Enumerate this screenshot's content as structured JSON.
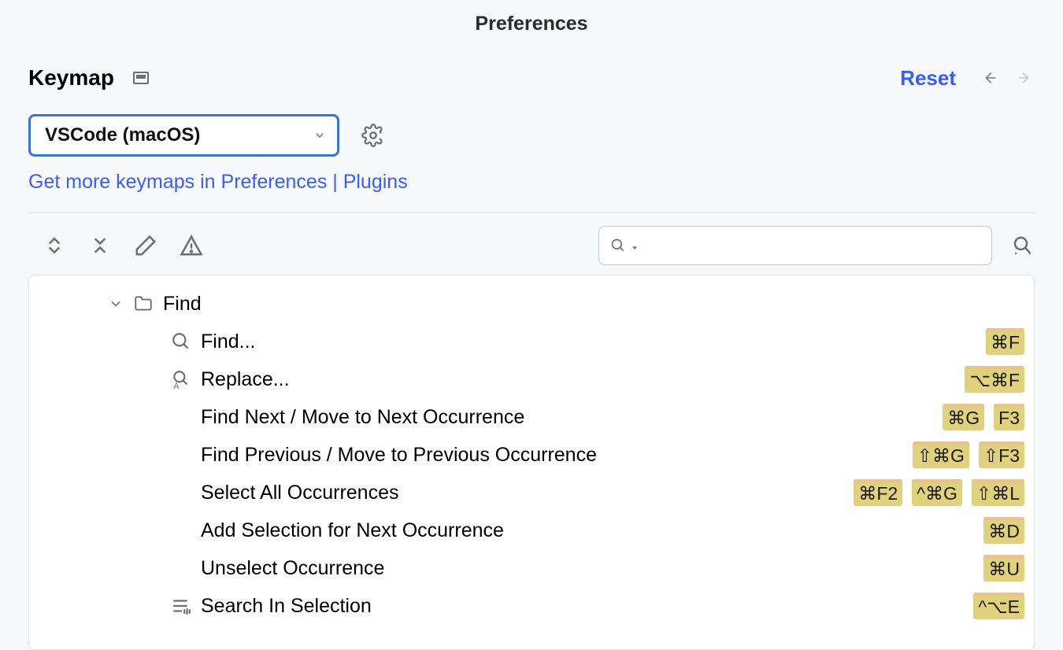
{
  "window_title": "Preferences",
  "section_title": "Keymap",
  "reset_label": "Reset",
  "keymap_selected": "VSCode (macOS)",
  "more_keymaps_link": "Get more keymaps in Preferences | Plugins",
  "search_placeholder": "",
  "tree": {
    "group_label": "Find",
    "items": [
      {
        "label": "Find...",
        "icon": "search",
        "shortcuts": [
          "⌘F"
        ]
      },
      {
        "label": "Replace...",
        "icon": "replace",
        "shortcuts": [
          "⌥⌘F"
        ]
      },
      {
        "label": "Find Next / Move to Next Occurrence",
        "icon": "",
        "shortcuts": [
          "⌘G",
          "F3"
        ]
      },
      {
        "label": "Find Previous / Move to Previous Occurrence",
        "icon": "",
        "shortcuts": [
          "⇧⌘G",
          "⇧F3"
        ]
      },
      {
        "label": "Select All Occurrences",
        "icon": "",
        "shortcuts": [
          "⌘F2",
          "^⌘G",
          "⇧⌘L"
        ]
      },
      {
        "label": "Add Selection for Next Occurrence",
        "icon": "",
        "shortcuts": [
          "⌘D"
        ]
      },
      {
        "label": "Unselect Occurrence",
        "icon": "",
        "shortcuts": [
          "⌘U"
        ]
      },
      {
        "label": "Search In Selection",
        "icon": "selection",
        "shortcuts": [
          "^⌥E"
        ]
      }
    ]
  }
}
